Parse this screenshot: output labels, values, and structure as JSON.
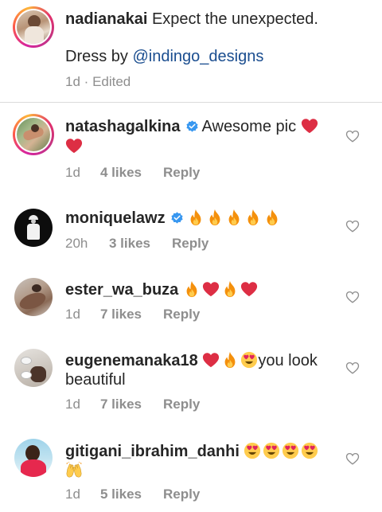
{
  "caption": {
    "username": "nadianakai",
    "text": "Expect the unexpected.",
    "dress_prefix": "Dress by ",
    "mention": "@indingo_designs",
    "time": "1d",
    "separator": "·",
    "edited": "Edited"
  },
  "comments": [
    {
      "username": "natashagalkina",
      "verified": true,
      "text": "Awesome pic",
      "time": "1d",
      "likes": "4 likes",
      "reply": "Reply"
    },
    {
      "username": "moniquelawz",
      "verified": true,
      "text": "",
      "time": "20h",
      "likes": "3 likes",
      "reply": "Reply"
    },
    {
      "username": "ester_wa_buza",
      "verified": false,
      "text": "",
      "time": "1d",
      "likes": "7 likes",
      "reply": "Reply"
    },
    {
      "username": "eugenemanaka18",
      "verified": false,
      "text": "you look",
      "text2": "beautiful",
      "time": "1d",
      "likes": "7 likes",
      "reply": "Reply"
    },
    {
      "username": "gitigani_ibrahim_danhi",
      "verified": false,
      "text": "",
      "time": "1d",
      "likes": "5 likes",
      "reply": "Reply"
    }
  ],
  "colors": {
    "mention": "#1a4d8f",
    "meta": "#8e8e8e",
    "verified": "#3897f0",
    "heart_emoji": "#e0245e",
    "fire_emoji": "#f4900c"
  }
}
